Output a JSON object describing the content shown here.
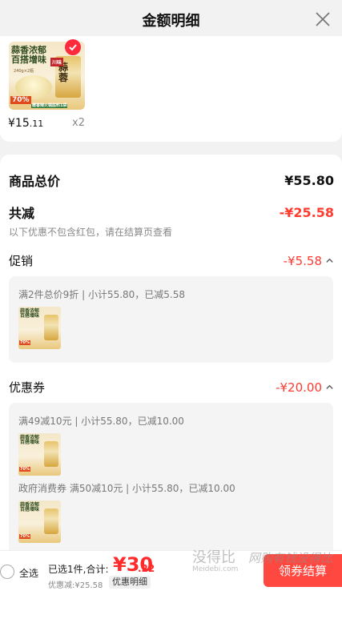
{
  "header": {
    "title": "金额明细",
    "close_icon": "close-icon"
  },
  "product": {
    "thumb_text": "蒜香浓郁 百搭增味",
    "thumb_tag": "240g×2瓶",
    "thumb_pct": "70%",
    "thumb_brand": "蒜蓉",
    "thumb_brand2": "川味",
    "thumb_gift": "赠香辣火锅底料1袋",
    "price_main": "¥15",
    "price_cents": ".11",
    "quantity": "x2"
  },
  "summary": {
    "total_label": "商品总价",
    "total_value": "¥55.80",
    "discount_label": "共减",
    "discount_value": "-¥25.58",
    "note": "以下优惠不包含红包，请在结算页查看"
  },
  "promotion": {
    "label": "促销",
    "value": "-¥5.58",
    "desc": "满2件总价9折 | 小计55.80，已减5.58"
  },
  "coupon": {
    "label": "优惠券",
    "value": "-¥20.00",
    "items": [
      {
        "desc": "满49减10元 | 小计55.80，已减10.00"
      },
      {
        "desc": "政府消费券 满50减10元 | 小计55.80，已减10.00"
      }
    ]
  },
  "bottom_bar": {
    "select_all": "全选",
    "selected": "已选1件,合计:",
    "total_main": "¥30",
    "total_cents": ".22",
    "discount_text": "优惠减:¥25.58",
    "detail_button": "优惠明细",
    "checkout_button": "领券结算"
  },
  "watermark": {
    "text": "没得比",
    "sub": "Meidebi.com",
    "slogan": "网购有钱没得比"
  },
  "colors": {
    "accent": "#ff3b30",
    "checkout": "#ff4940",
    "background": "#f2f2f2"
  }
}
